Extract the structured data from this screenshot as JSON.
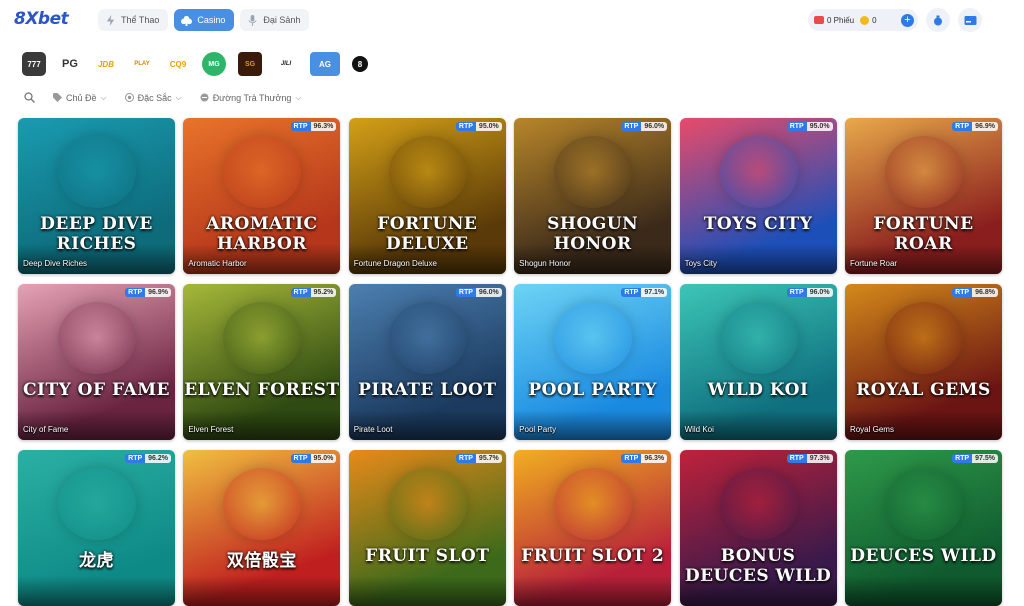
{
  "header": {
    "logo": "8Xbet",
    "tabs": [
      {
        "label": "Thể Thao",
        "icon": "lightning-icon"
      },
      {
        "label": "Casino",
        "icon": "club-icon"
      },
      {
        "label": "Đại Sảnh",
        "icon": "microphone-icon"
      }
    ],
    "wallet": {
      "tickets_label": "0 Phiếu",
      "coins_value": "0"
    }
  },
  "providers": [
    "777",
    "PG",
    "JDB",
    "PLAY",
    "CQ9",
    "MG",
    "SG",
    "JILI",
    "AG",
    "8"
  ],
  "filters": [
    {
      "label": "Chủ Đề"
    },
    {
      "label": "Đặc Sắc"
    },
    {
      "label": "Đường Trả Thưởng"
    }
  ],
  "games": [
    {
      "name": "Deep Dive Riches",
      "title": "DEEP DIVE RICHES",
      "rtp": "",
      "colors": [
        "#0d6b7a",
        "#1a9bb0"
      ]
    },
    {
      "name": "Aromatic Harbor",
      "title": "AROMATIC HARBOR",
      "rtp": "96.3%",
      "colors": [
        "#b5361b",
        "#e8742a"
      ]
    },
    {
      "name": "Fortune Dragon Deluxe",
      "title": "FORTUNE DELUXE",
      "rtp": "95.0%",
      "colors": [
        "#5a3a08",
        "#d4a017"
      ]
    },
    {
      "name": "Shogun Honor",
      "title": "SHOGUN HONOR",
      "rtp": "96.0%",
      "colors": [
        "#3b2a1a",
        "#b8862a"
      ]
    },
    {
      "name": "Toys City",
      "title": "TOYS CITY",
      "rtp": "95.0%",
      "colors": [
        "#1d4fb8",
        "#e84b6a"
      ]
    },
    {
      "name": "Fortune Roar",
      "title": "FORTUNE ROAR",
      "rtp": "96.9%",
      "colors": [
        "#8a1e1e",
        "#e8a94a"
      ]
    },
    {
      "name": "City of Fame",
      "title": "CITY OF FAME",
      "rtp": "96.9%",
      "colors": [
        "#6b2440",
        "#e6a2b6"
      ]
    },
    {
      "name": "Elven Forest",
      "title": "ELVEN FOREST",
      "rtp": "95.2%",
      "colors": [
        "#2f4a12",
        "#a6b83a"
      ]
    },
    {
      "name": "Pirate Loot",
      "title": "PIRATE LOOT",
      "rtp": "96.0%",
      "colors": [
        "#1b3a5e",
        "#4c7fb0"
      ]
    },
    {
      "name": "Pool Party",
      "title": "POOL PARTY",
      "rtp": "97.1%",
      "colors": [
        "#1a8ae0",
        "#6dd4f4"
      ]
    },
    {
      "name": "Wild Koi",
      "title": "WILD KOI",
      "rtp": "96.0%",
      "colors": [
        "#0f6f7e",
        "#3cc6b7"
      ]
    },
    {
      "name": "Royal Gems",
      "title": "ROYAL GEMS",
      "rtp": "96.8%",
      "colors": [
        "#6a1414",
        "#d48a1a"
      ]
    },
    {
      "name": "",
      "title": "龙虎",
      "rtp": "96.2%",
      "colors": [
        "#0e8a86",
        "#2bb0a4"
      ]
    },
    {
      "name": "",
      "title": "双倍骰宝",
      "rtp": "95.0%",
      "colors": [
        "#c01f1f",
        "#f0c040"
      ]
    },
    {
      "name": "",
      "title": "FRUIT SLOT",
      "rtp": "95.7%",
      "colors": [
        "#3d6a1a",
        "#e88a1a"
      ]
    },
    {
      "name": "",
      "title": "FRUIT SLOT 2",
      "rtp": "96.3%",
      "colors": [
        "#b8203a",
        "#f0b020"
      ]
    },
    {
      "name": "",
      "title": "BONUS DEUCES WILD",
      "rtp": "97.3%",
      "colors": [
        "#3a1a4a",
        "#c0223a"
      ]
    },
    {
      "name": "",
      "title": "DEUCES WILD",
      "rtp": "97.5%",
      "colors": [
        "#0f5a2e",
        "#2e9a4a"
      ]
    }
  ]
}
